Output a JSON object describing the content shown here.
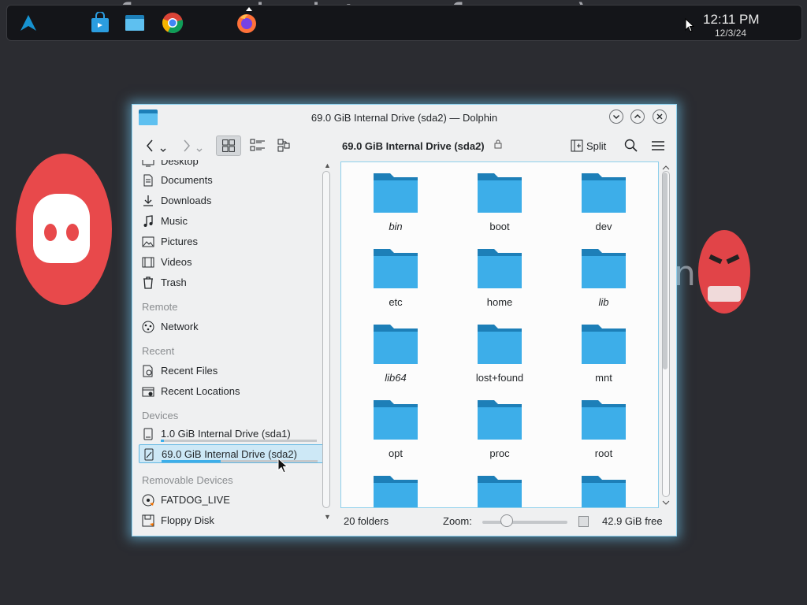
{
  "wallpaper_text": "fun noob vietnam funny :)",
  "taskbar": {
    "time": "12:11 PM",
    "date": "12/3/24",
    "icons": [
      "arch-launcher-icon",
      "store-icon",
      "files-icon",
      "chrome-icon",
      "firefox-icon"
    ]
  },
  "window": {
    "title": "69.0 GiB Internal Drive (sda2) — Dolphin",
    "location": "69.0 GiB Internal Drive (sda2)",
    "split_label": "Split"
  },
  "sidebar": {
    "places": [
      {
        "label": "Desktop",
        "icon": "desktop-icon"
      },
      {
        "label": "Documents",
        "icon": "documents-icon"
      },
      {
        "label": "Downloads",
        "icon": "downloads-icon"
      },
      {
        "label": "Music",
        "icon": "music-icon"
      },
      {
        "label": "Pictures",
        "icon": "pictures-icon"
      },
      {
        "label": "Videos",
        "icon": "videos-icon"
      },
      {
        "label": "Trash",
        "icon": "trash-icon"
      }
    ],
    "remote_header": "Remote",
    "remote": [
      {
        "label": "Network",
        "icon": "network-icon"
      }
    ],
    "recent_header": "Recent",
    "recent": [
      {
        "label": "Recent Files",
        "icon": "recent-files-icon"
      },
      {
        "label": "Recent Locations",
        "icon": "recent-locations-icon"
      }
    ],
    "devices_header": "Devices",
    "devices": [
      {
        "label": "1.0 GiB Internal Drive (sda1)",
        "icon": "drive-icon",
        "usage": 0.02
      },
      {
        "label": "69.0 GiB Internal Drive (sda2)",
        "icon": "drive-icon",
        "usage": 0.38
      }
    ],
    "removable_header": "Removable Devices",
    "removable": [
      {
        "label": "FATDOG_LIVE",
        "icon": "optical-disc-icon"
      },
      {
        "label": "Floppy Disk",
        "icon": "floppy-icon"
      }
    ]
  },
  "files": [
    {
      "name": "bin",
      "italic": true
    },
    {
      "name": "boot",
      "italic": false
    },
    {
      "name": "dev",
      "italic": false
    },
    {
      "name": "etc",
      "italic": false
    },
    {
      "name": "home",
      "italic": false
    },
    {
      "name": "lib",
      "italic": true
    },
    {
      "name": "lib64",
      "italic": true
    },
    {
      "name": "lost+found",
      "italic": false
    },
    {
      "name": "mnt",
      "italic": false
    },
    {
      "name": "opt",
      "italic": false
    },
    {
      "name": "proc",
      "italic": false
    },
    {
      "name": "root",
      "italic": false
    },
    {
      "name": "",
      "italic": false
    },
    {
      "name": "",
      "italic": false
    },
    {
      "name": "",
      "italic": false
    }
  ],
  "status": {
    "count": "20 folders",
    "zoom_label": "Zoom:",
    "zoom_level": 0.25,
    "free": "42.9 GiB free"
  },
  "colors": {
    "accent": "#3daee9",
    "folder_front": "#3daee9",
    "folder_back": "#1d7fb8"
  }
}
